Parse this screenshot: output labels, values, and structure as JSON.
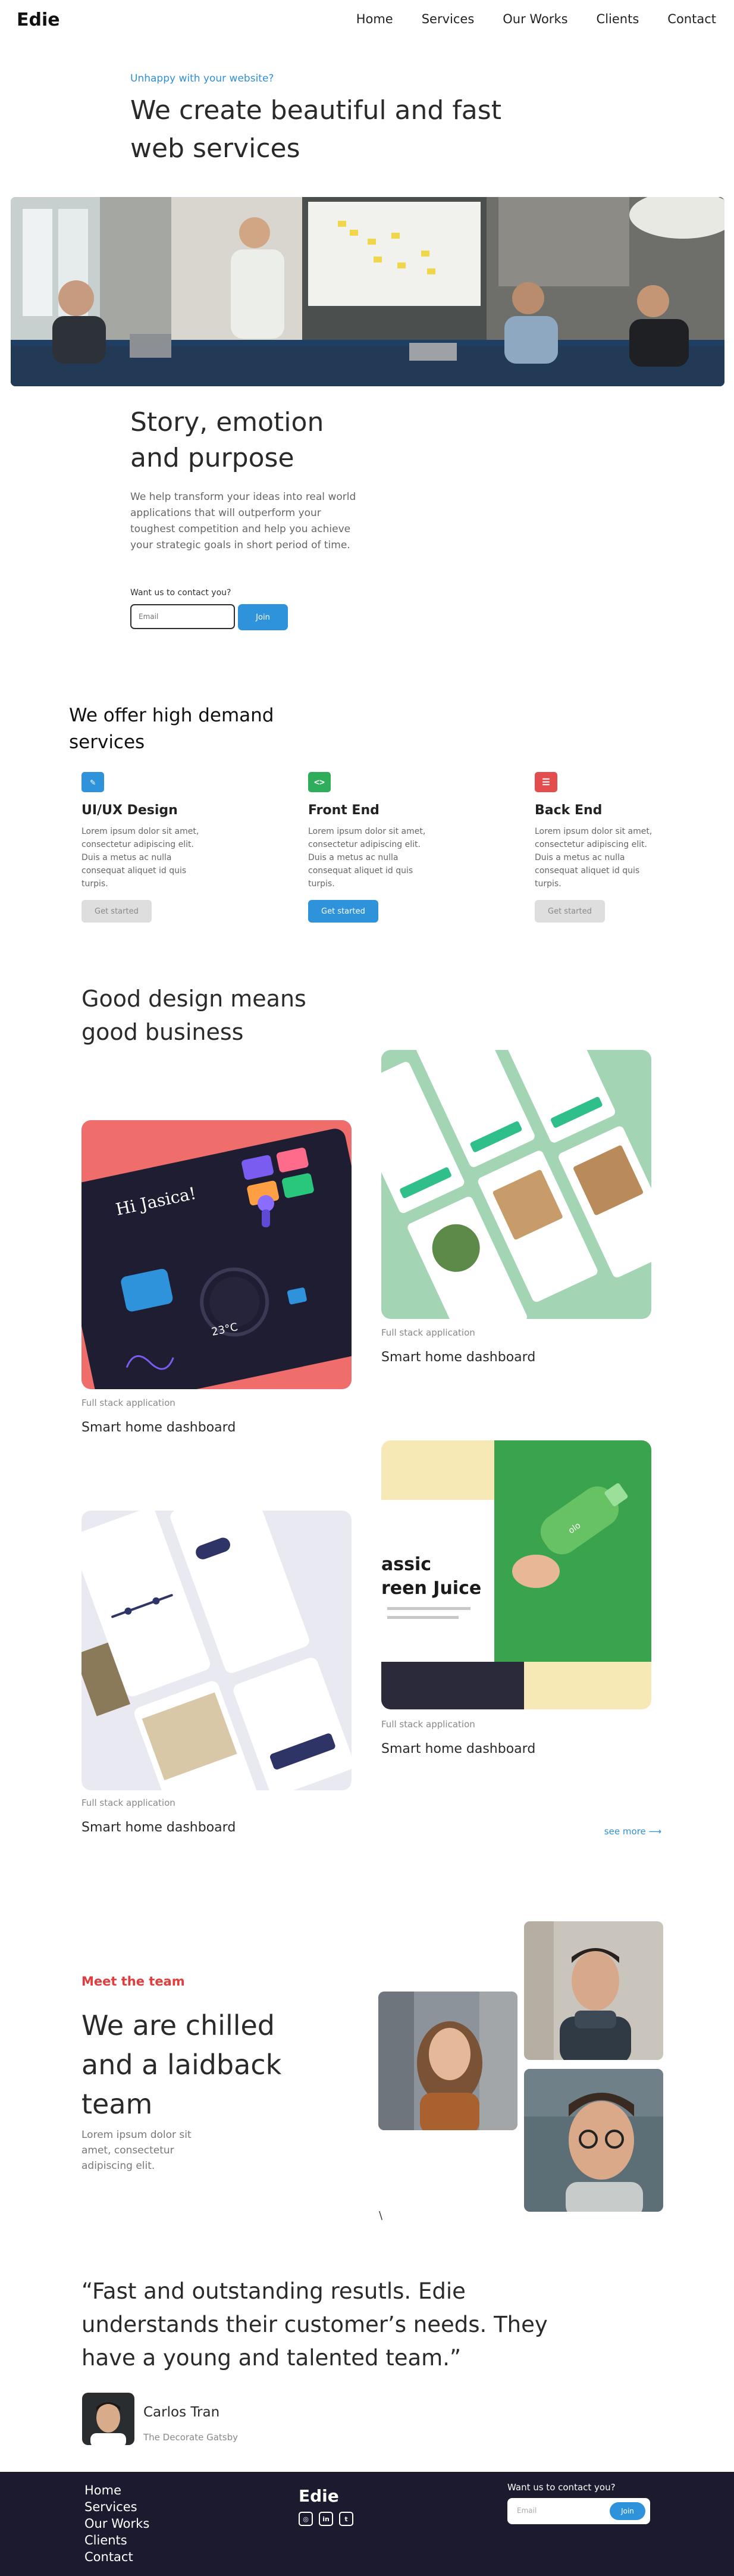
{
  "header": {
    "logo": "Edie",
    "nav": [
      "Home",
      "Services",
      "Our Works",
      "Clients",
      "Contact"
    ]
  },
  "hero": {
    "eyebrow": "Unhappy with your website?",
    "title": "We create beautiful and fast web services"
  },
  "story": {
    "title": "Story, emotion and purpose",
    "text": "We help transform your ideas into real world applications that will outperform your toughest competition and help you achieve your strategic goals in short period of time.",
    "contact_label": "Want us to contact you?",
    "email_placeholder": "Email",
    "join_label": "Join"
  },
  "services": {
    "title": "We offer high demand services",
    "items": [
      {
        "title": "UI/UX Design",
        "text": "Lorem ipsum dolor sit amet, consectetur adipiscing elit. Duis a metus ac nulla consequat aliquet id quis turpis.",
        "button": "Get started",
        "icon": "pencil-icon",
        "color": "#2f93dc"
      },
      {
        "title": "Front End",
        "text": "Lorem ipsum dolor sit amet, consectetur adipiscing elit. Duis a metus ac nulla consequat aliquet id quis turpis.",
        "button": "Get started",
        "icon": "code-icon",
        "color": "#2ead5b"
      },
      {
        "title": "Back End",
        "text": "Lorem ipsum dolor sit amet, consectetur adipiscing elit. Duis a metus ac nulla consequat aliquet id quis turpis.",
        "button": "Get started",
        "icon": "server-icon",
        "color": "#e44d4d"
      }
    ]
  },
  "portfolio": {
    "title": "Good design means good business",
    "cards": [
      {
        "sub": "Full stack application",
        "title": "Smart home dashboard"
      },
      {
        "sub": "Full stack application",
        "title": "Smart home dashboard"
      },
      {
        "sub": "Full stack application",
        "title": "Smart home dashboard"
      },
      {
        "sub": "Full stack application",
        "title": "Smart home dashboard"
      }
    ],
    "mock_texts": {
      "dashboard_greeting": "Hi Jasica!",
      "dashboard_temp": "23°C",
      "juice_heading": "assic reen Juice"
    },
    "see_more": "see more"
  },
  "team": {
    "eyebrow": "Meet the team",
    "title": "We are chilled and a laidback team",
    "text": "Lorem ipsum dolor sit amet, consectetur adipiscing elit.",
    "slash": "\\"
  },
  "quote": {
    "text": "“Fast and outstanding resutls. Edie understands their customer’s needs. They have a young and talented team.”",
    "name": "Carlos Tran",
    "role": "The Decorate Gatsby"
  },
  "footer": {
    "links": [
      "Home",
      "Services",
      "Our Works",
      "Clients",
      "Contact"
    ],
    "logo": "Edie",
    "social": [
      "instagram-icon",
      "linkedin-icon",
      "twitter-icon"
    ],
    "social_glyphs": [
      "◎",
      "in",
      "t"
    ],
    "contact_label": "Want us to contact you?",
    "email_placeholder": "Email",
    "join_label": "Join"
  }
}
